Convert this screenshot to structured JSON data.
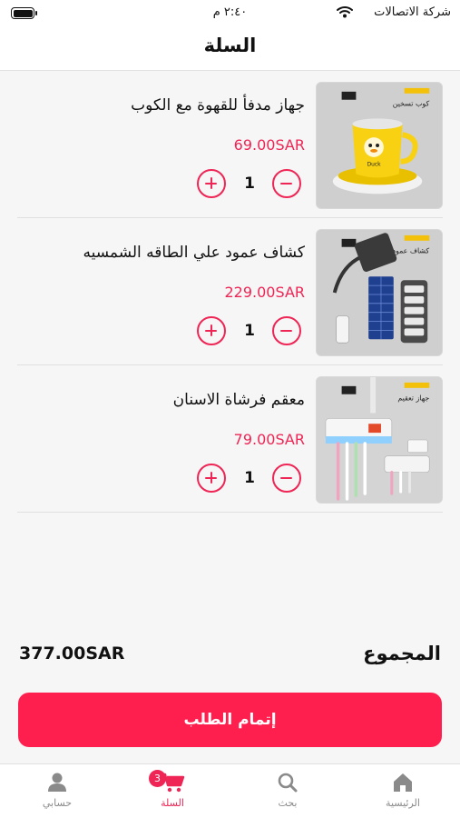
{
  "status_bar": {
    "carrier": "شركة الاتصالات",
    "time": "٢:٤٠ م"
  },
  "header": {
    "title": "السلة"
  },
  "cart": {
    "items": [
      {
        "name": "جهاز مدفأ للقهوة مع الكوب",
        "price": "69.00SAR",
        "quantity": "1",
        "image_caption": "كوب تسخين",
        "image_brand": "Duck"
      },
      {
        "name": "كشاف عمود علي الطاقه الشمسيه",
        "price": "229.00SAR",
        "quantity": "1",
        "image_caption": "كشاف عمود",
        "image_brand": ""
      },
      {
        "name": "معقم فرشاة الاسنان",
        "price": "79.00SAR",
        "quantity": "1",
        "image_caption": "جهاز تعقيم",
        "image_brand": ""
      }
    ]
  },
  "summary": {
    "total_label": "المجموع",
    "total_value": "377.00SAR"
  },
  "checkout": {
    "label": "إتمام الطلب"
  },
  "tabbar": {
    "items": [
      {
        "label": "الرئيسية",
        "icon": "home-icon"
      },
      {
        "label": "بحث",
        "icon": "search-icon"
      },
      {
        "label": "السلة",
        "icon": "cart-icon",
        "badge": "3",
        "active": true
      },
      {
        "label": "حسابي",
        "icon": "user-icon"
      }
    ]
  },
  "colors": {
    "accent": "#ee2555",
    "button": "#ff1f4e",
    "background": "#f6f6f6"
  }
}
